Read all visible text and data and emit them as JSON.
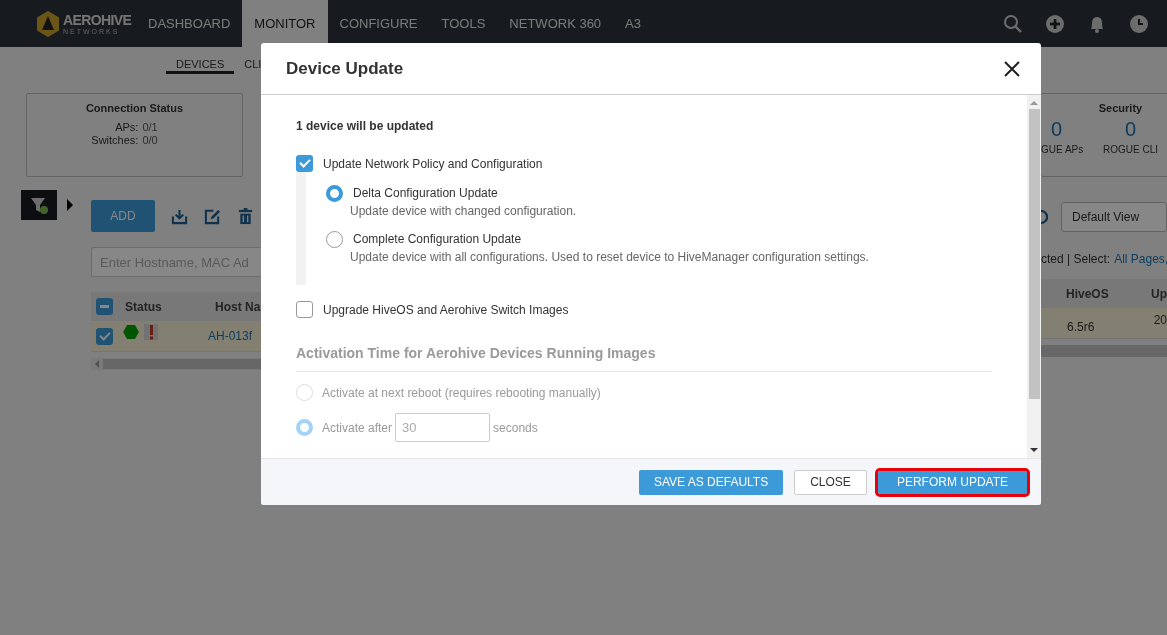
{
  "nav": {
    "brand": "AEROHIVE",
    "brand_sub": "NETWORKS",
    "items": [
      {
        "label": "DASHBOARD",
        "selected": false
      },
      {
        "label": "MONITOR",
        "selected": true
      },
      {
        "label": "CONFIGURE",
        "selected": false
      },
      {
        "label": "TOOLS",
        "selected": false
      },
      {
        "label": "NETWORK 360",
        "selected": false
      },
      {
        "label": "A3",
        "selected": false
      }
    ]
  },
  "subtabs": [
    {
      "label": "DEVICES",
      "selected": true
    },
    {
      "label": "CLI",
      "selected": false
    }
  ],
  "connection_status": {
    "title": "Connection Status",
    "rows": [
      {
        "label": "APs:",
        "value": "0/1"
      },
      {
        "label": "Switches:",
        "value": "0/0"
      }
    ]
  },
  "toolbar": {
    "add_button": "ADD"
  },
  "search": {
    "placeholder": "Enter Hostname, MAC Ad"
  },
  "table": {
    "select_all_partial": true,
    "columns": [
      "Status",
      "Host Na"
    ],
    "rows": [
      {
        "selected": true,
        "host": "AH-013f"
      }
    ]
  },
  "right_panel": {
    "security": {
      "title": "Security",
      "stats": [
        {
          "value": "0",
          "label": "GUE APs"
        },
        {
          "value": "0",
          "label": "ROGUE CLI"
        }
      ]
    },
    "view_select": "Default View",
    "selection_text": "cted | Select:",
    "select_link": "All Pages,",
    "columns": [
      "HiveOS",
      "Up"
    ],
    "cells": [
      "6.5r6",
      "20"
    ]
  },
  "dialog": {
    "title": "Device Update",
    "summary": "1 device will be updated",
    "options": [
      {
        "label": "Update Network Policy and Configuration",
        "checked": true,
        "choices": [
          {
            "label": "Delta Configuration Update",
            "description": "Update device with changed configuration.",
            "selected": true
          },
          {
            "label": "Complete Configuration Update",
            "description": "Update device with all configurations. Used to reset device to HiveManager configuration settings.",
            "selected": false
          }
        ]
      },
      {
        "label": "Upgrade HiveOS and Aerohive Switch Images",
        "checked": false
      }
    ],
    "activation": {
      "title": "Activation Time for Aerohive Devices Running Images",
      "disabled": true,
      "choices": [
        {
          "label": "Activate at next reboot (requires rebooting manually)",
          "selected": false
        },
        {
          "label": "Activate after",
          "value": "30",
          "suffix": "seconds",
          "selected": true
        }
      ]
    },
    "buttons": [
      {
        "label": "SAVE AS DEFAULTS",
        "kind": "primary",
        "highlighted": false
      },
      {
        "label": "CLOSE",
        "kind": "secondary",
        "highlighted": false
      },
      {
        "label": "PERFORM UPDATE",
        "kind": "primary",
        "highlighted": true
      }
    ]
  }
}
